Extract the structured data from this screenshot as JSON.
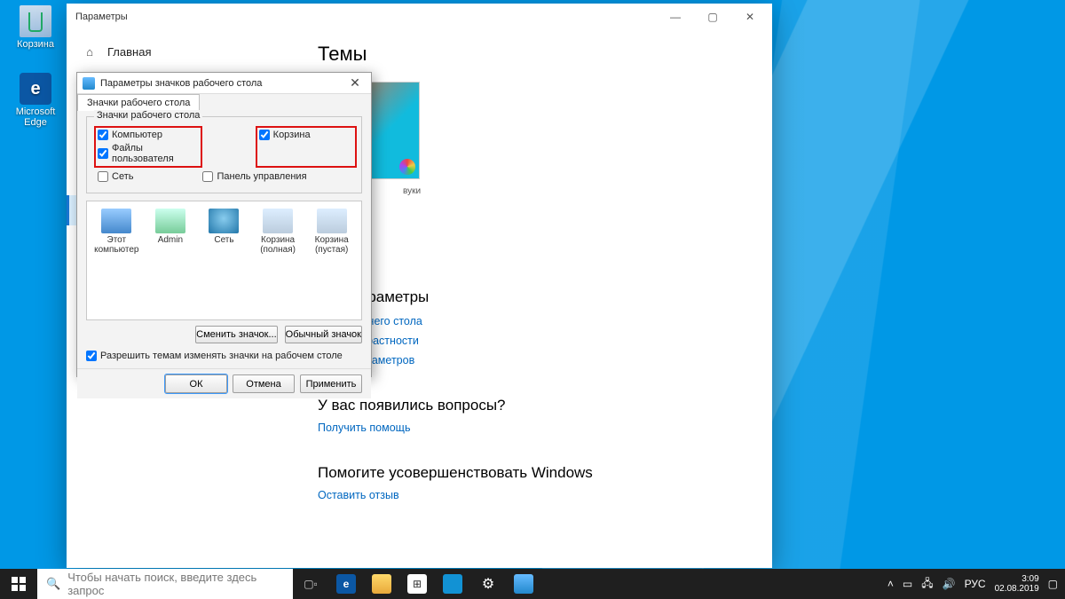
{
  "desktop": {
    "recycle": "Корзина",
    "edge": "Microsoft Edge"
  },
  "settings": {
    "title": "Параметры",
    "home": "Главная",
    "main_heading": "Темы",
    "sounds_hint": "вуки",
    "related_heading": "щие параметры",
    "link_icons": "чков рабочего стола",
    "link_contrast": "окой контрастности",
    "link_sync": "ваших параметров",
    "questions": "У вас появились вопросы?",
    "get_help": "Получить помощь",
    "improve": "Помогите усовершенствовать Windows",
    "feedback": "Оставить отзыв"
  },
  "dialog": {
    "title": "Параметры значков рабочего стола",
    "tab": "Значки рабочего стола",
    "group_legend": "Значки рабочего стола",
    "chk_computer": "Компьютер",
    "chk_userfiles": "Файлы пользователя",
    "chk_network": "Сеть",
    "chk_recycle": "Корзина",
    "chk_cpanel": "Панель управления",
    "icons": {
      "pc": "Этот компьютер",
      "admin": "Admin",
      "net": "Сеть",
      "bin_full": "Корзина (полная)",
      "bin_empty": "Корзина (пустая)"
    },
    "btn_change": "Сменить значок...",
    "btn_default": "Обычный значок",
    "allow_themes": "Разрешить темам изменять значки на рабочем столе",
    "ok": "ОК",
    "cancel": "Отмена",
    "apply": "Применить"
  },
  "taskbar": {
    "search_placeholder": "Чтобы начать поиск, введите здесь запрос",
    "lang": "РУС",
    "time": "3:09",
    "date": "02.08.2019"
  }
}
